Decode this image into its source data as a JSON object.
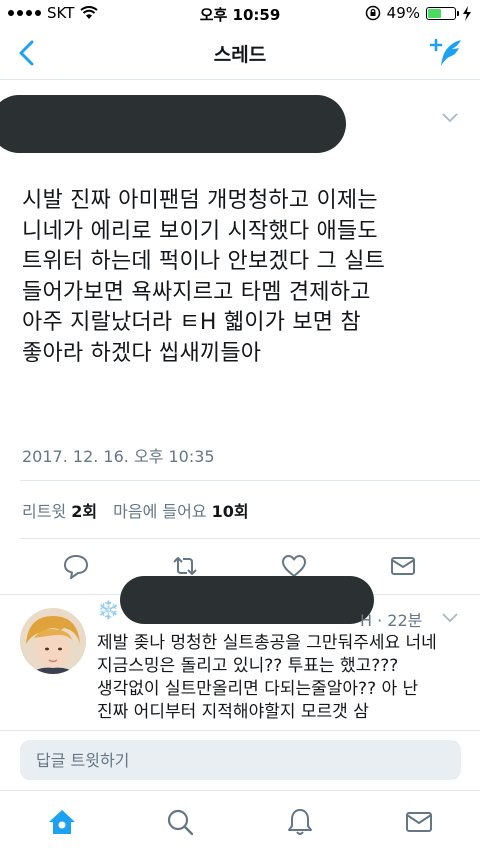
{
  "status_bar": {
    "carrier": "SKT",
    "time": "오후 10:59",
    "battery_percent_text": "49%",
    "battery_level": 0.49
  },
  "nav": {
    "title": "스레드"
  },
  "tweet": {
    "text": "시발 진짜 아미팬덤 개멍청하고 이제는\n니네가 에리로 보이기 시작했다 애들도\n트위터 하는데 퍽이나 안보겠다 그 실트\n들어가보면 욕싸지르고 타멤 견제하고\n아주 지랄났더라 ㅌH 혧이가 보면 참\n좋아라 하겠다 씹새끼들아",
    "timestamp": "2017. 12. 16. 오후 10:35",
    "retweet_label": "리트윗",
    "retweet_count": "2회",
    "like_label": "마음에 들어요",
    "like_count": "10회"
  },
  "reply": {
    "flake": "❄️",
    "handle_suffix": "H · 22분",
    "text": "제발 좆나 멍청한 실트총공을 그만둬주세요 너네\n지금스밍은 돌리고 있니?? 투표는 했고???\n생각없이 실트만올리면 다되는줄알아?? 아 난\n진짜 어디부터 지적해야할지 모르갯 삼"
  },
  "composer": {
    "placeholder": "답글 트윗하기"
  },
  "colors": {
    "accent": "#1da1f2",
    "icon_gray": "#657786",
    "redaction": "#2b3033"
  }
}
